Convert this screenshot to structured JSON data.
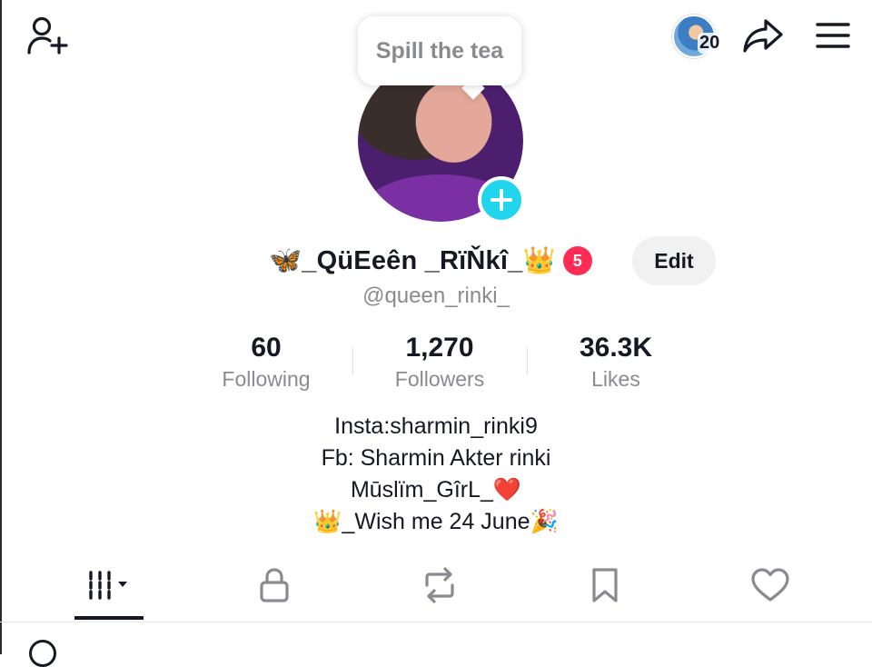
{
  "header": {
    "add_friend_icon": "person-plus-icon",
    "visitors_count": "20",
    "share_icon": "share-arrow-icon",
    "menu_icon": "hamburger-menu-icon"
  },
  "bubble": {
    "text": "Spill the tea"
  },
  "profile": {
    "display_name": "🦋_QüEeên _RïŇkî_👑",
    "notification_count": "5",
    "edit_label": "Edit",
    "handle": "@queen_rinki_"
  },
  "stats": {
    "following": {
      "value": "60",
      "label": "Following"
    },
    "followers": {
      "value": "1,270",
      "label": "Followers"
    },
    "likes": {
      "value": "36.3K",
      "label": "Likes"
    }
  },
  "bio": {
    "line1": "Insta:sharmin_rinki9",
    "line2": "Fb: Sharmin Akter rinki",
    "line3": "Mūslïm_GîrL_❤️",
    "line4": "👑_Wish me 24 June🎉"
  },
  "tabs": [
    {
      "name": "videos",
      "icon": "grid-icon",
      "active": true
    },
    {
      "name": "private",
      "icon": "lock-icon",
      "active": false
    },
    {
      "name": "reposts",
      "icon": "repost-icon",
      "active": false
    },
    {
      "name": "favorites",
      "icon": "bookmark-icon",
      "active": false
    },
    {
      "name": "liked",
      "icon": "heart-icon",
      "active": false
    }
  ],
  "colors": {
    "accent_cyan": "#20d5ec",
    "badge_red": "#fe2c55",
    "text_primary": "#161823",
    "text_secondary": "#8a8b91"
  }
}
